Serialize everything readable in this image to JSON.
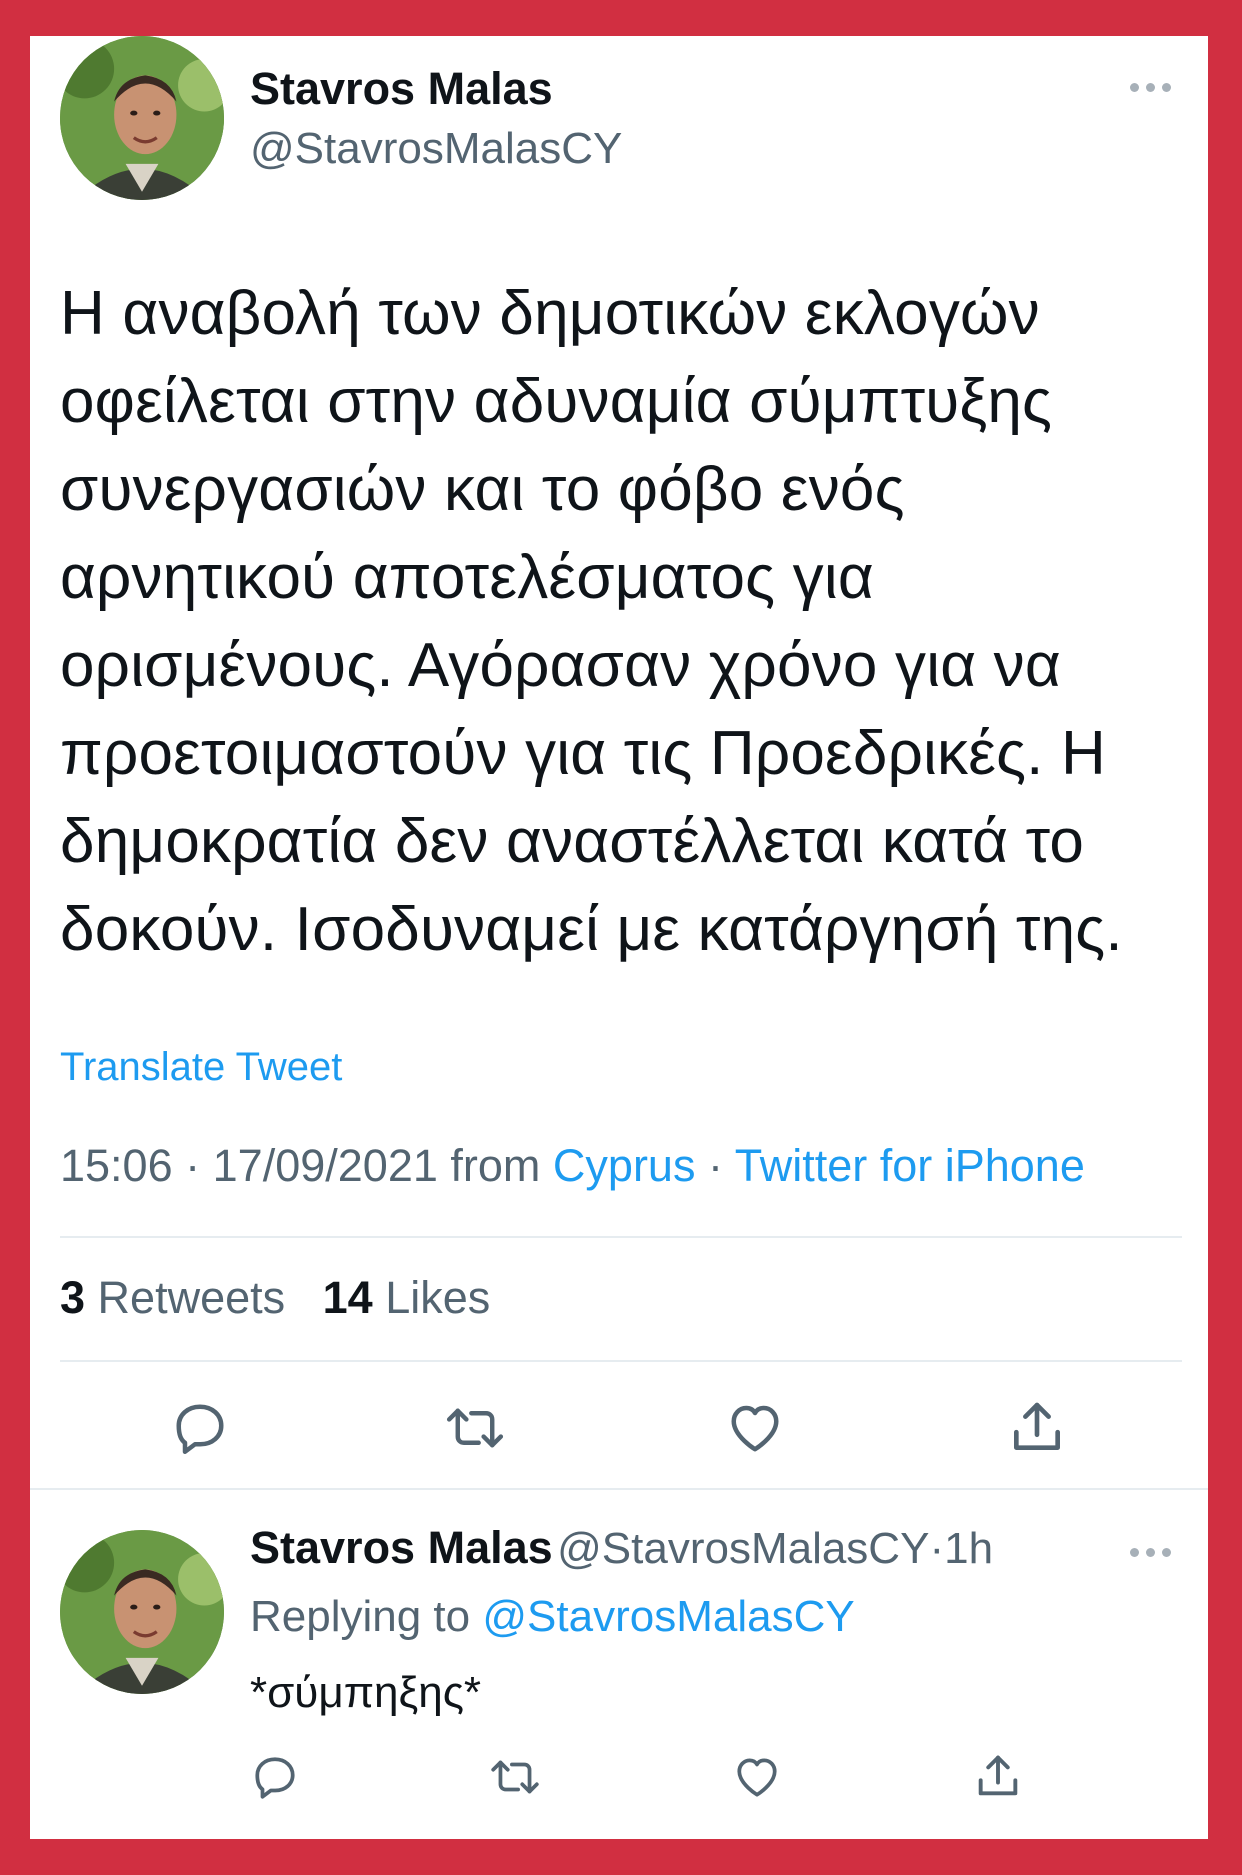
{
  "tweet": {
    "display_name": "Stavros Malas",
    "handle": "@StavrosMalasCY",
    "text": "Η αναβολή των δημοτικών εκλογών\nοφείλεται στην αδυναμία σύμπτυξης\nσυνεργασιών και το φόβο ενός\nαρνητικού αποτελέσματος για\nορισμένους.  Αγόρασαν χρόνο για να\nπροετοιμαστούν για τις Προεδρικές. Η\nδημοκρατία δεν αναστέλλεται κατά το\nδοκούν. Ισοδυναμεί με κατάργησή της.",
    "translate_label": "Translate Tweet",
    "time": "15:06",
    "date": "17/09/2021",
    "from_label": "from",
    "location": "Cyprus",
    "source": "Twitter for iPhone",
    "separator": "·",
    "retweets_count": "3",
    "retweets_label": "Retweets",
    "likes_count": "14",
    "likes_label": "Likes"
  },
  "reply": {
    "display_name": "Stavros Malas",
    "handle": "@StavrosMalasCY",
    "separator": "·",
    "age": "1h",
    "replying_to_label": "Replying to",
    "replying_to_handle": "@StavrosMalasCY",
    "text": "*σύμπηξης*"
  },
  "icons": {
    "more": "more-horizontal-icon",
    "reply": "reply-icon",
    "retweet": "retweet-icon",
    "like": "heart-icon",
    "share": "share-icon"
  },
  "colors": {
    "frame": "#d12f41",
    "link": "#1d9bf0",
    "secondary_text": "#536471"
  }
}
